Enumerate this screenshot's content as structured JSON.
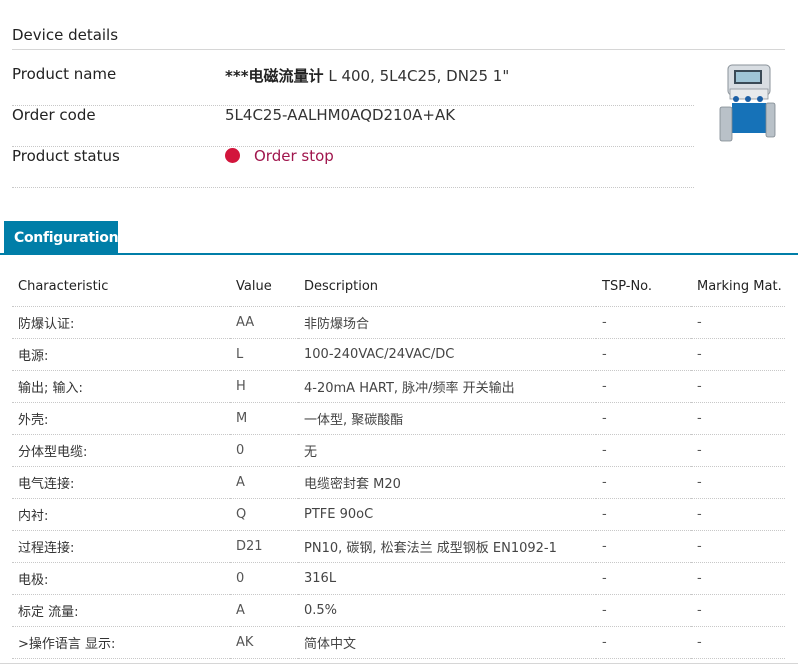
{
  "device_details": {
    "heading": "Device details",
    "product_name_label": "Product name",
    "product_name_prefix": "***电磁流量计",
    "product_name_rest": " L 400, 5L4C25, DN25 1\"",
    "order_code_label": "Order code",
    "order_code": "5L4C25-AALHM0AQD210A+AK",
    "status_label": "Product status",
    "status": "Order stop",
    "status_color": "#d2153c"
  },
  "tab": {
    "label": "Configuration",
    "color": "#007ea8"
  },
  "table": {
    "headers": [
      "Characteristic",
      "Value",
      "Description",
      "TSP-No.",
      "Marking Mat."
    ],
    "rows": [
      [
        "防爆认证:",
        "AA",
        "非防爆场合",
        "-",
        "-"
      ],
      [
        "电源:",
        "L",
        "100-240VAC/24VAC/DC",
        "-",
        "-"
      ],
      [
        "输出; 输入:",
        "H",
        "4-20mA HART, 脉冲/频率 开关输出",
        "-",
        "-"
      ],
      [
        "外壳:",
        "M",
        "一体型, 聚碳酸酯",
        "-",
        "-"
      ],
      [
        "分体型电缆:",
        "0",
        "无",
        "-",
        "-"
      ],
      [
        "电气连接:",
        "A",
        "电缆密封套 M20",
        "-",
        "-"
      ],
      [
        "内衬:",
        "Q",
        "PTFE 90oC",
        "-",
        "-"
      ],
      [
        "过程连接:",
        "D21",
        "PN10, 碳钢, 松套法兰 成型钢板 EN1092-1",
        "-",
        "-"
      ],
      [
        "电极:",
        "0",
        "316L",
        "-",
        "-"
      ],
      [
        "标定 流量:",
        "A",
        "0.5%",
        "-",
        "-"
      ],
      [
        ">操作语言 显示:",
        "AK",
        "简体中文",
        "-",
        "-"
      ]
    ]
  }
}
